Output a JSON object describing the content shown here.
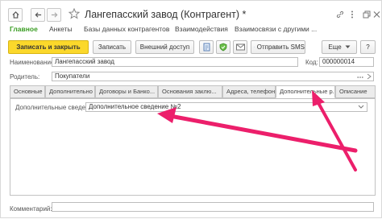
{
  "window": {
    "title": "Лангепасский завод (Контрагент) *"
  },
  "nav": {
    "items": [
      {
        "label": "Главное",
        "active": true
      },
      {
        "label": "Анкеты"
      },
      {
        "label": "Базы данных контрагентов"
      },
      {
        "label": "Взаимодействия"
      },
      {
        "label": "Взаимосвязи с другими ..."
      }
    ]
  },
  "toolbar": {
    "save_close_label": "Записать и закрыть",
    "save_label": "Записать",
    "external_access_label": "Внешний доступ",
    "send_sms_label": "Отправить SMS",
    "more_label": "Еще",
    "help_label": "?"
  },
  "form": {
    "name_label": "Наименование:",
    "name_value": "Лангепасский завод",
    "code_label": "Код:",
    "code_value": "000000014",
    "parent_label": "Родитель:",
    "parent_value": "Покупатели",
    "comment_label": "Комментарий:",
    "comment_value": ""
  },
  "tabs": [
    {
      "label": "Основные"
    },
    {
      "label": "Дополнительно"
    },
    {
      "label": "Договоры и Банко..."
    },
    {
      "label": "Основания заклю..."
    },
    {
      "label": "Адреса, телефоны"
    },
    {
      "label": "Дополнительные р...",
      "active": true
    },
    {
      "label": "Описание"
    }
  ],
  "additional_panel": {
    "field_label": "Дополнительные сведения:",
    "field_value": "Дополнительное сведение №2"
  },
  "colors": {
    "accent_green": "#3a9d23",
    "primary_button": "#fbd82b",
    "annotation_arrow": "#ec1f6b"
  }
}
